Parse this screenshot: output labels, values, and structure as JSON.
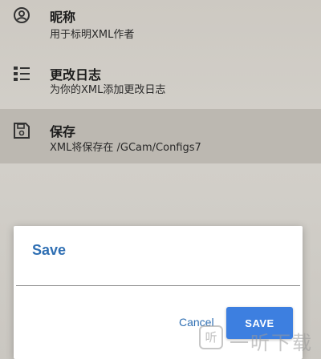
{
  "settings": {
    "items": [
      {
        "title": "昵称",
        "subtitle": "用于标明XML作者",
        "icon": "account-circle-icon"
      },
      {
        "title": "更改日志",
        "subtitle": "为你的XML添加更改日志",
        "icon": "list-icon"
      },
      {
        "title": "保存",
        "subtitle": "XML将保存在 /GCam/Configs7",
        "icon": "save-icon"
      }
    ]
  },
  "dialog": {
    "title": "Save",
    "input_value": "",
    "cancel_label": "Cancel",
    "save_label": "SAVE"
  },
  "watermark": {
    "text": "一听下载",
    "logo_text": "听"
  },
  "colors": {
    "accent": "#3d7fe0",
    "link": "#2f6fb3",
    "highlight_row": "#bcb8b1"
  }
}
